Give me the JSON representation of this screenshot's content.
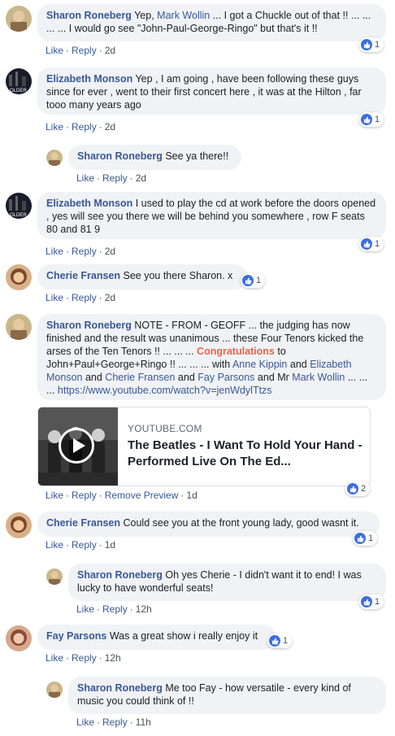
{
  "comments": [
    {
      "name": "Sharon Roneberg",
      "pre": " Yep, ",
      "mention": "Mark Wollin",
      "post": " ... I got a Chuckle out of that !! ... ... ... ... I would go see \"John-Paul-George-Ringo\" but that's it !!",
      "like": "Like",
      "reply": "Reply",
      "time": "2d",
      "count": "1"
    },
    {
      "name": "Elizabeth Monson",
      "text": " Yep , I am going , have been following these guys since for ever , went to their first concert here , it was at the Hilton , far tooo many years ago",
      "like": "Like",
      "reply": "Reply",
      "time": "2d",
      "count": "1"
    },
    {
      "name": "Sharon Roneberg",
      "text": " See ya there!!",
      "like": "Like",
      "reply": "Reply",
      "time": "2d"
    },
    {
      "name": "Elizabeth Monson",
      "text": " I used to play the cd at work before the doors opened , yes will see you there we will be behind you somewhere , row F seats 80 and 81 9",
      "like": "Like",
      "reply": "Reply",
      "time": "2d",
      "count": "1"
    },
    {
      "name": "Cherie Fransen",
      "text": " See you there Sharon. x",
      "like": "Like",
      "reply": "Reply",
      "time": "2d",
      "count": "1"
    },
    {
      "name": "Sharon Roneberg",
      "t1": " NOTE - FROM - GEOFF ... the judging has now finished and the result was unanimous ... these Four Tenors kicked the arses of the Ten Tenors !! ... ... ... ",
      "congrats": "Congratulations",
      "t2": " to John+Paul+George+Ringo !! ... ... ... with ",
      "m1": "Anne Kippin",
      "t3": " and ",
      "m2": "Elizabeth Monson",
      "t4": " and ",
      "m3": "Cherie Fransen",
      "t5": " and ",
      "m4": "Fay Parsons",
      "t6": " and Mr ",
      "m5": "Mark Wollin",
      "t7": " ... ... ... ",
      "url": "https://www.youtube.com/watch?v=jenWdylTtzs",
      "like": "Like",
      "reply": "Reply",
      "remove": "Remove Preview",
      "time": "1d",
      "count": "2"
    },
    {
      "name": "Cherie Fransen",
      "text": " Could see you at the front young lady, good wasnt it.",
      "like": "Like",
      "reply": "Reply",
      "time": "1d",
      "count": "1"
    },
    {
      "name": "Sharon Roneberg",
      "text": " Oh yes Cherie - I didn't want it to end! I was lucky to have wonderful seats!",
      "like": "Like",
      "reply": "Reply",
      "time": "12h",
      "count": "1"
    },
    {
      "name": "Fay Parsons",
      "text": " Was a great show i really enjoy it",
      "like": "Like",
      "reply": "Reply",
      "time": "12h",
      "count": "1"
    },
    {
      "name": "Sharon Roneberg",
      "text": " Me too Fay - how versatile - every kind of music you could think of !!",
      "like": "Like",
      "reply": "Reply",
      "time": "11h"
    }
  ],
  "preview": {
    "site": "YOUTUBE.COM",
    "title": "The Beatles - I Want To Hold Your Hand - Performed Live On The Ed..."
  },
  "colors": {
    "name": "#385898",
    "bubble": "#f0f2f5",
    "like": "#3b6ee0",
    "highlight": "#e9644a"
  },
  "icons": {
    "like": "thumbs-up-icon",
    "play": "play-icon"
  }
}
